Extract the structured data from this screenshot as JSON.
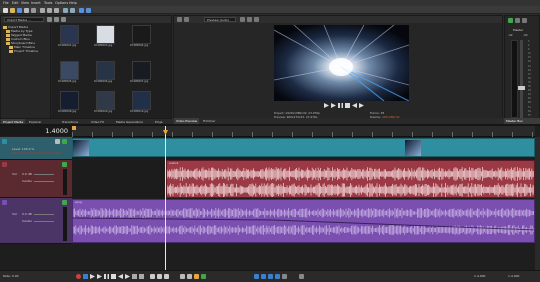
{
  "menu": [
    "File",
    "Edit",
    "View",
    "Insert",
    "Tools",
    "Options",
    "Help"
  ],
  "colors": {
    "video_track": "#2f8fa0",
    "audio_track_1": "#9b3a44",
    "audio_track_2": "#7a4fb0",
    "playhead": "#e8a640",
    "accent_green": "#40a84a",
    "accent_blue": "#3a7fd0"
  },
  "explorer": {
    "dropdown_value": "Import Media ...",
    "tree": [
      {
        "label": "Import Media"
      },
      {
        "label": "Media by Type"
      },
      {
        "label": "Tagged Media"
      },
      {
        "label": "Custom Bins"
      },
      {
        "label": "Storyboard Bins"
      },
      {
        "label": "Main Timeline"
      },
      {
        "label": "Project Timeline"
      }
    ],
    "thumbnails": [
      "DCIM0001.jpg",
      "DCIM0003.jpg",
      "DCIM0004.jpg",
      "DCIM0005.jpg",
      "DCIM0006.jpg",
      "DCIM0007.jpg",
      "DCIM0008.jpg",
      "DCIM0009.jpg",
      "DCIM0010.jpg"
    ]
  },
  "left_tabs": [
    "Project Media",
    "Explorer",
    "Transitions",
    "Video FX",
    "Media Generators",
    "Proje"
  ],
  "preview": {
    "dropdown_value": "Preview (Auto)",
    "project_info": "Project: 1920x1080x32, 23.976p",
    "preview_info": "Preview: 960x270x32, 23.976p",
    "display_info": "Display: 497x280x32",
    "frame_label": "Frame:",
    "frame_value": "28",
    "display_label": "Display:",
    "display_value": "497x280x32",
    "tabs": [
      "Video Preview",
      "Trimmer"
    ]
  },
  "master": {
    "title": "Master",
    "left_value": "-Inf.",
    "right_value": "-Inf.",
    "scale": [
      "3",
      "6",
      "9",
      "12",
      "15",
      "18",
      "21",
      "24",
      "27",
      "30",
      "33",
      "36",
      "39",
      "42",
      "45",
      "48",
      "51",
      "54",
      "57"
    ],
    "bottom_tab": "Master Bus"
  },
  "timeline": {
    "time_display": "1.4000",
    "tracks": [
      {
        "name": "Level: 100.0 %",
        "type": "video"
      },
      {
        "name": "Vol:",
        "vol": "0.0 dB",
        "pan": "Center",
        "type": "audio"
      },
      {
        "name": "Vol:",
        "vol": "0.0 dB",
        "pan": "Center",
        "type": "audio"
      }
    ],
    "clip_audio_label": "audio1",
    "clip_song_label": "song",
    "rate": "Rate: 0.00",
    "end_time": "1.4.000",
    "position": "1.4.000"
  }
}
